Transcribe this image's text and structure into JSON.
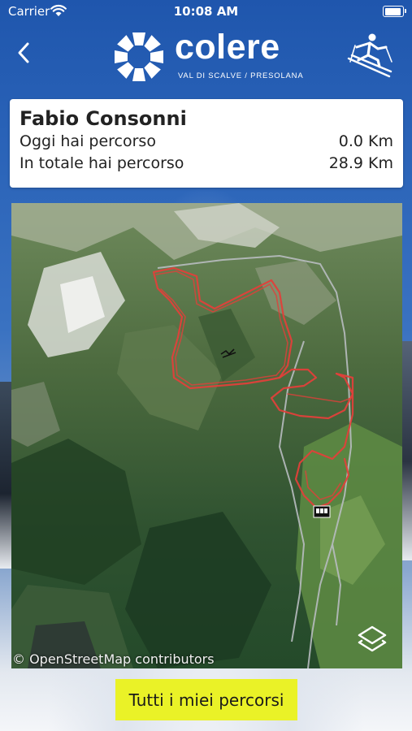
{
  "status_bar": {
    "carrier": "Carrier",
    "time": "10:08 AM"
  },
  "header": {
    "logo_word": "colere",
    "logo_subtitle": "VAL DI SCALVE / PRESOLANA",
    "back_icon": "chevron-left-icon",
    "profile_icon": "skier-icon"
  },
  "user_card": {
    "name": "Fabio Consonni",
    "today_label": "Oggi hai percorso",
    "today_value": "0.0 Km",
    "total_label": "In totale hai percorso",
    "total_value": "28.9 Km"
  },
  "map": {
    "attribution": "© OpenStreetMap contributors",
    "layers_icon": "layers-icon",
    "track_color": "#e0403a",
    "road_color": "#b8bcc0"
  },
  "footer": {
    "button_label": "Tutti i miei percorsi",
    "button_color": "#eaf227"
  }
}
